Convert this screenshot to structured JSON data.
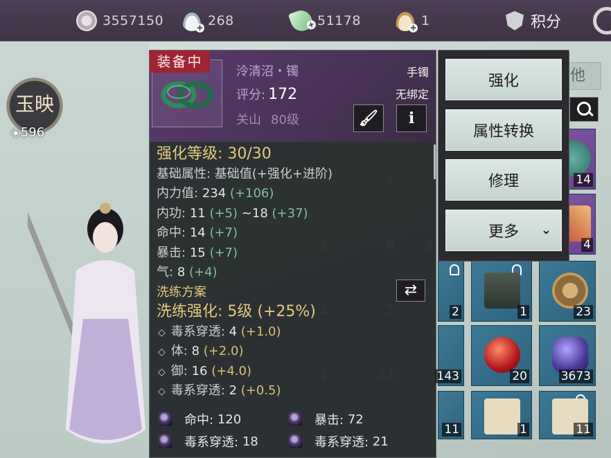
{
  "currencies": [
    {
      "icon": "film-reel-icon",
      "value": "3557150"
    },
    {
      "icon": "silver-bowl-icon",
      "value": "268"
    },
    {
      "icon": "jade-leaf-icon",
      "value": "51178"
    },
    {
      "icon": "cake-icon",
      "value": "1"
    }
  ],
  "score_label": "积分",
  "character": {
    "emblem_text": "玉映",
    "power": "596"
  },
  "item": {
    "equipped_tag": "装备中",
    "name": "泠清沼・镯",
    "slot": "手镯",
    "score_label": "评分:",
    "score_value": "172",
    "binding": "无绑定",
    "region": "关山",
    "level": "80级"
  },
  "stats": {
    "enhance_level": "强化等级: 30/30",
    "base_attr": "基础属性: 基础值(+强化+进阶)",
    "lines": [
      {
        "label": "内力值:",
        "value": "234",
        "bonus": "(+106)"
      },
      {
        "label": "内功:",
        "value": "11",
        "bonus": "(+5)",
        "value2": "~18",
        "bonus2": "(+37)"
      },
      {
        "label": "命中:",
        "value": "14",
        "bonus": "(+7)"
      },
      {
        "label": "暴击:",
        "value": "15",
        "bonus": "(+7)"
      },
      {
        "label": "气:",
        "value": "8",
        "bonus": "(+4)"
      }
    ]
  },
  "refine": {
    "title": "洗练方案",
    "enhance": "洗练强化: 5级 (+25%)",
    "lines": [
      {
        "label": "毒系穿透:",
        "value": "4",
        "bonus": "(+1.0)"
      },
      {
        "label": "体:",
        "value": "8",
        "bonus": "(+2.0)"
      },
      {
        "label": "御:",
        "value": "16",
        "bonus": "(+4.0)"
      },
      {
        "label": "毒系穿透:",
        "value": "2",
        "bonus": "(+0.5)"
      }
    ]
  },
  "gems": [
    {
      "label": "命中:",
      "value": "120"
    },
    {
      "label": "暴击:",
      "value": "72"
    },
    {
      "label": "毒系穿透:",
      "value": "18"
    },
    {
      "label": "毒系穿透:",
      "value": "21"
    }
  ],
  "menu": [
    "强化",
    "属性转换",
    "修理",
    "更多"
  ],
  "filter_text": "他",
  "inventory_counts": [
    "14",
    "4",
    "2",
    "1",
    "23",
    "143",
    "20",
    "3673",
    "11",
    "1",
    "11"
  ],
  "background_counts": [
    "2",
    "1",
    "8",
    "5",
    "2",
    "53",
    "3",
    "1"
  ]
}
